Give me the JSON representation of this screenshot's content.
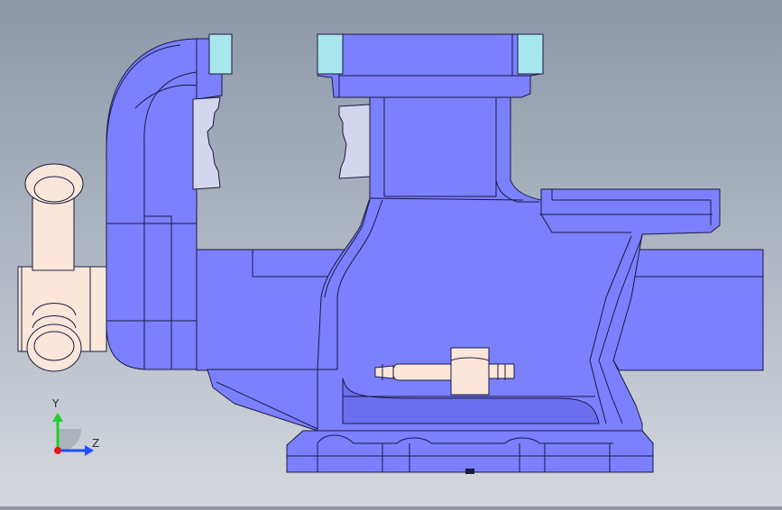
{
  "viewport": {
    "background_top": "#8d98a8",
    "background_bottom": "#d5d8de"
  },
  "colors": {
    "body": "#7b80ff",
    "body_dark": "#6a6ff0",
    "outline": "#1a1a40",
    "jaw_plate": "#a9e7ee",
    "jaw_face": "#d4d6ee",
    "handle": "#fbe7da",
    "axis_y": "#1fcf2c",
    "axis_z": "#1c4fff",
    "axis_x": "#e01818"
  },
  "triad": {
    "y_label": "Y",
    "z_label": "Z"
  }
}
